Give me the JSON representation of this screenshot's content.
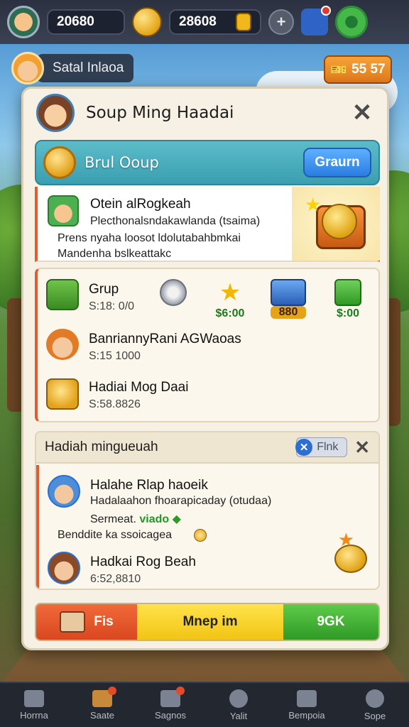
{
  "hud": {
    "score": "20680",
    "coins": "28608",
    "add_label": "+"
  },
  "sub_hud": {
    "player_name": "Satal Inlaoa",
    "gems": "55 57"
  },
  "modal": {
    "title": "Soup Ming Haadai",
    "close": "✕",
    "group_bar": {
      "label": "Brul Ooup",
      "button": "Graurn"
    },
    "card1": {
      "title": "Otein alRogkeah",
      "line": "Plecthonalsndakawlanda (tsaima)",
      "desc1": "Prens nyaha loosot ldolutabahbmkai",
      "desc2": "Mandenha bslkeattakc"
    },
    "panel2": {
      "rows": [
        {
          "title": "Grup",
          "sub": "S:18: 0/0"
        },
        {
          "title": "BanriannyRani AGWaoas",
          "sub": "S:15 1000"
        },
        {
          "title": "Hadiai Mog Daai",
          "sub": "S:58.8826"
        }
      ],
      "items": [
        {
          "value": ""
        },
        {
          "value": "$6:00"
        },
        {
          "value": "880"
        },
        {
          "value": "$:00"
        }
      ]
    },
    "section3": {
      "title": "Hadiah mingueuah",
      "pill_label": "Flnk",
      "close": "✕",
      "rows": [
        {
          "title": "Halahe Rlap haoeik",
          "line": "Hadalaahon fhoarapicaday (otudaa)",
          "extra_prefix": "Sermeat.",
          "extra_green": "viado",
          "extra2": "Benddite ka ssoicagea"
        },
        {
          "title": "Hadkai Rog Beah",
          "sub": "6:52,8810"
        }
      ]
    },
    "bottom": {
      "left": "Fis",
      "middle": "Mnep  im",
      "right": "9GK"
    }
  },
  "nav": [
    {
      "label": "Horrna"
    },
    {
      "label": "Saate"
    },
    {
      "label": "Sagnos"
    },
    {
      "label": "Yalit"
    },
    {
      "label": "Bempoia"
    },
    {
      "label": "Sope"
    }
  ]
}
